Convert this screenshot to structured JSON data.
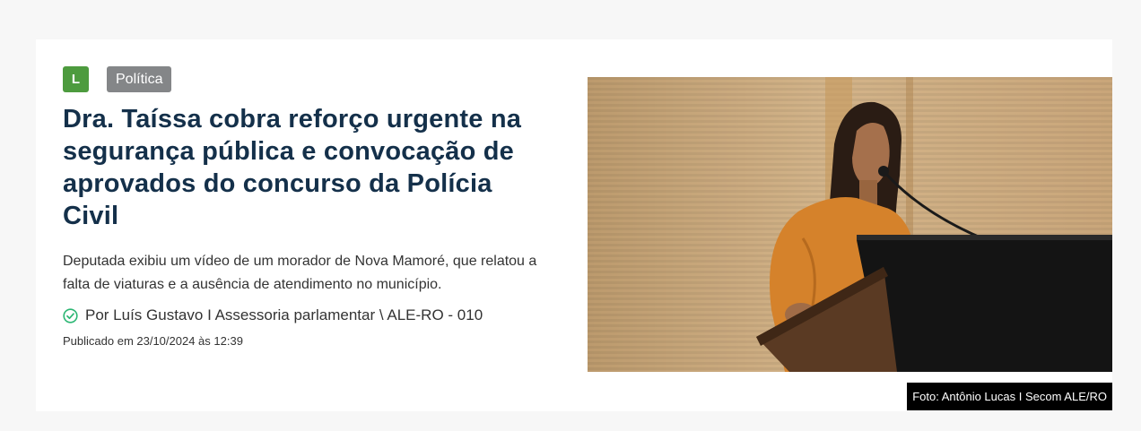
{
  "article": {
    "tag_letter": "L",
    "category": "Política",
    "title": "Dra. Taíssa cobra reforço urgente na segurança pública e convocação de aprovados do concurso da Polícia Civil",
    "summary": "Deputada exibiu um vídeo de um morador de Nova Mamoré, que relatou a falta de viaturas e a ausência de atendimento no município.",
    "author": "Por Luís Gustavo I Assessoria parlamentar \\ ALE-RO - 010",
    "published": "Publicado em 23/10/2024 às 12:39",
    "photo_caption": "Foto: Antônio Lucas I Secom ALE/RO"
  },
  "colors": {
    "tag_letter_bg": "#4d9b3e",
    "category_bg": "#848688",
    "title": "#14304a",
    "verified_icon": "#2bb673"
  },
  "icons": {
    "verified": "check-circle-icon"
  }
}
